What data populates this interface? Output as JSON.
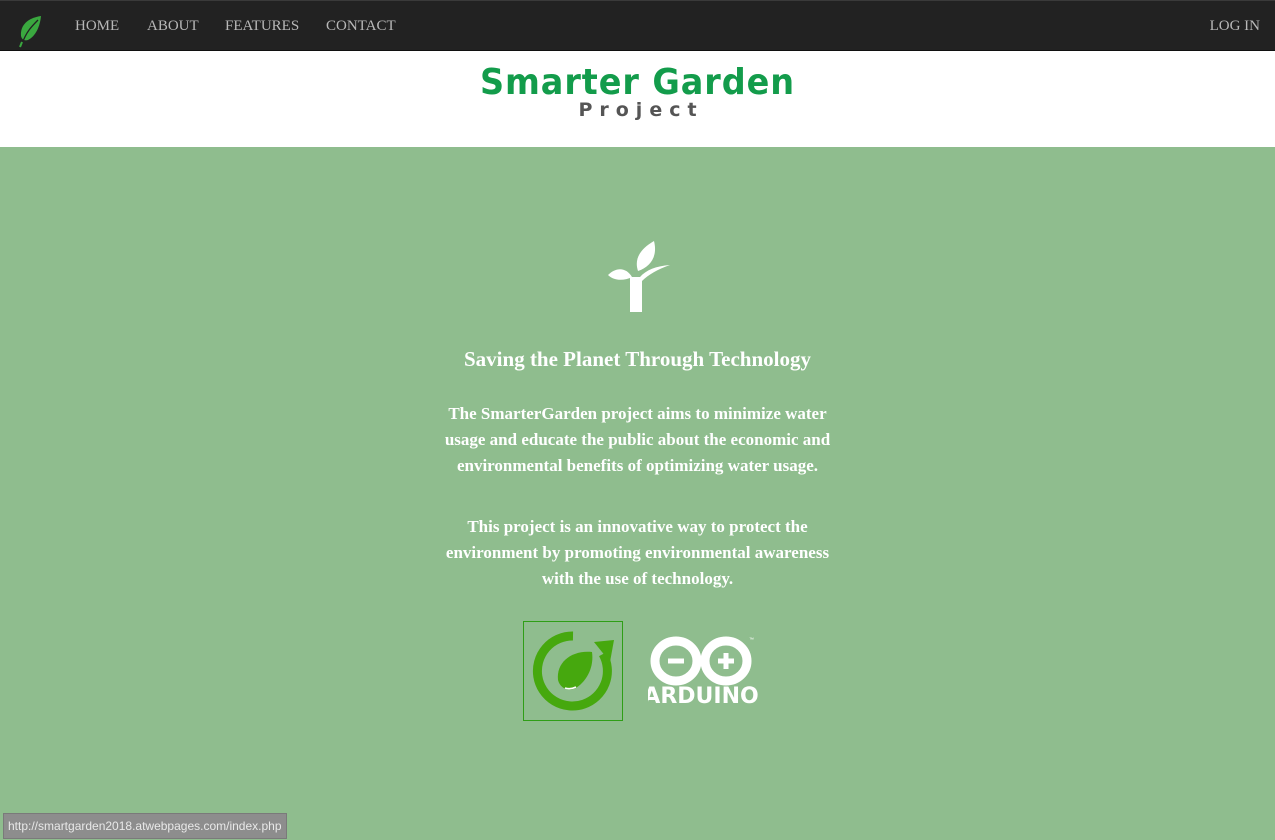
{
  "nav": {
    "logo_icon": "leaf-icon",
    "items": [
      {
        "label": "HOME"
      },
      {
        "label": "ABOUT"
      },
      {
        "label": "FEATURES"
      },
      {
        "label": "CONTACT"
      }
    ],
    "login_label": "LOG IN"
  },
  "header": {
    "title": "Smarter Garden",
    "subtitle": "Project"
  },
  "main": {
    "hero_icon": "sprout-icon",
    "headline": "Saving the Planet Through Technology",
    "paragraphs": [
      "The SmarterGarden project aims to minimize water usage and educate the public about the economic and environmental benefits of optimizing water usage.",
      "This project is an innovative way to protect the environment by promoting environmental awareness with the use of technology."
    ],
    "logos": {
      "eco_logo": "eco-refresh-leaf-icon",
      "arduino_text": "ARDUINO",
      "arduino_icon": "arduino-infinity-icon"
    }
  },
  "status_bar": {
    "url": "http://smartgarden2018.atwebpages.com/index.php"
  },
  "colors": {
    "navbar": "#222222",
    "nav_text": "#b8b8b8",
    "brand_green": "#139c4b",
    "brand_gray": "#555555",
    "main_bg": "#8fbd8e",
    "eco_green": "#46a80e"
  }
}
